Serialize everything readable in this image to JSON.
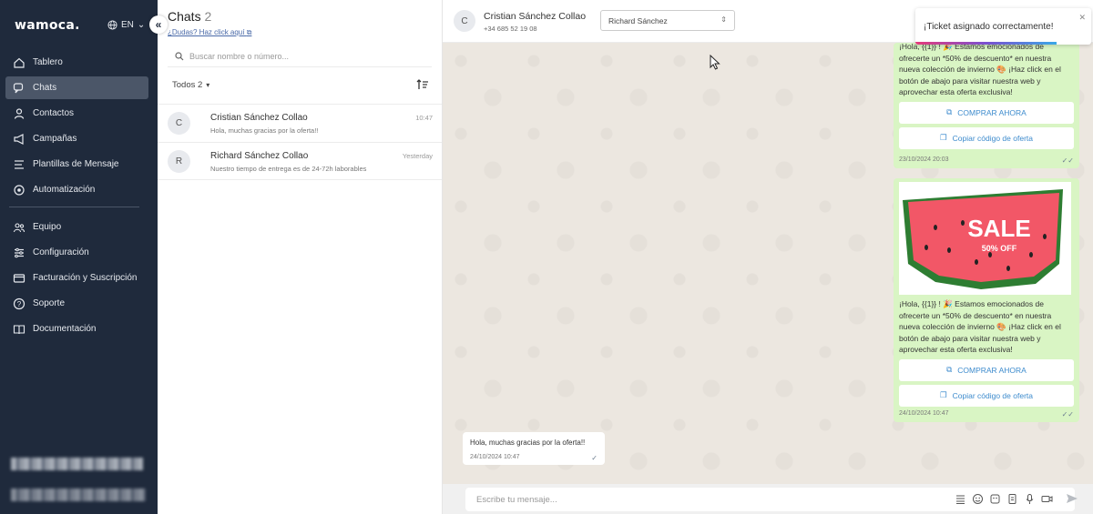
{
  "app": {
    "logo": "wamoca.",
    "language": "EN",
    "collapse_icon": "«"
  },
  "sidebar": {
    "items": [
      {
        "label": "Tablero",
        "icon": "house-icon"
      },
      {
        "label": "Chats",
        "icon": "chat-icon",
        "active": true
      },
      {
        "label": "Contactos",
        "icon": "person-icon"
      },
      {
        "label": "Campañas",
        "icon": "megaphone-icon"
      },
      {
        "label": "Plantillas de Mensaje",
        "icon": "template-icon"
      },
      {
        "label": "Automatización",
        "icon": "automation-icon"
      },
      {
        "label": "Equipo",
        "icon": "team-icon"
      },
      {
        "label": "Configuración",
        "icon": "sliders-icon"
      },
      {
        "label": "Facturación y Suscripción",
        "icon": "card-icon"
      },
      {
        "label": "Soporte",
        "icon": "help-icon"
      },
      {
        "label": "Documentación",
        "icon": "book-icon"
      }
    ]
  },
  "chatlist": {
    "title": "Chats",
    "count": "2",
    "help_link": "¿Dudas? Haz click aquí",
    "search_placeholder": "Buscar nombre o número...",
    "filter_label": "Todos 2",
    "chats": [
      {
        "initial": "C",
        "name": "Cristian Sánchez Collao",
        "preview": "Hola, muchas gracias por la oferta!!",
        "time": "10:47"
      },
      {
        "initial": "R",
        "name": "Richard Sánchez Collao",
        "preview": "Nuestro tiempo de entrega es de 24-72h laborables",
        "time": "Yesterday"
      }
    ]
  },
  "conversation": {
    "avatar_initial": "C",
    "contact_name": "Cristian Sánchez Collao",
    "contact_phone": "+34 685 52 19 08",
    "assignee": "Richard Sánchez",
    "toast": "¡Ticket asignado correctamente!",
    "messages": [
      {
        "text": "¡Hola, {{1}} ! 🎉 Estamos emocionados de ofrecerte un *50% de descuento* en nuestra nueva colección de invierno 🎨 ¡Haz click en el botón de abajo para visitar nuestra web y aprovechar esta oferta exclusiva!",
        "button_primary": "COMPRAR AHORA",
        "button_secondary": "Copiar código de oferta",
        "timestamp": "23/10/2024 20:03"
      },
      {
        "image_title": "SALE",
        "image_subtitle": "50% OFF",
        "text": "¡Hola, {{1}} ! 🎉 Estamos emocionados de ofrecerte un *50% de descuento* en nuestra nueva colección de invierno 🎨 ¡Haz click en el botón de abajo para visitar nuestra web y aprovechar esta oferta exclusiva!",
        "button_primary": "COMPRAR AHORA",
        "button_secondary": "Copiar código de oferta",
        "timestamp": "24/10/2024 10:47"
      },
      {
        "text": "Hola, muchas gracias por la oferta!!",
        "timestamp": "24/10/2024 10:47"
      }
    ],
    "composer_placeholder": "Escribe tu mensaje..."
  },
  "colors": {
    "sidebar_bg": "#1f2a3c",
    "outgoing_bubble": "#d9f5c4",
    "link_blue": "#3d8bcd",
    "chat_bg": "#ece7e0"
  }
}
